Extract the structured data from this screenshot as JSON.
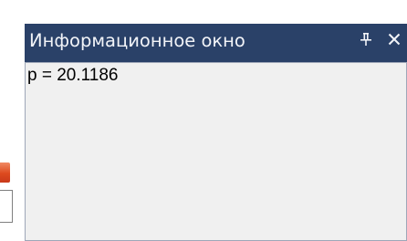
{
  "window": {
    "title": "Информационное окно",
    "pin_icon": "pin-icon",
    "close_icon": "close-icon"
  },
  "content": {
    "text": "p = 20.1186"
  },
  "colors": {
    "title_bar": "#2a4168",
    "title_text": "#f2f4f8",
    "content_background": "#f0f0f0",
    "left_tab": "#dd4a1e"
  }
}
